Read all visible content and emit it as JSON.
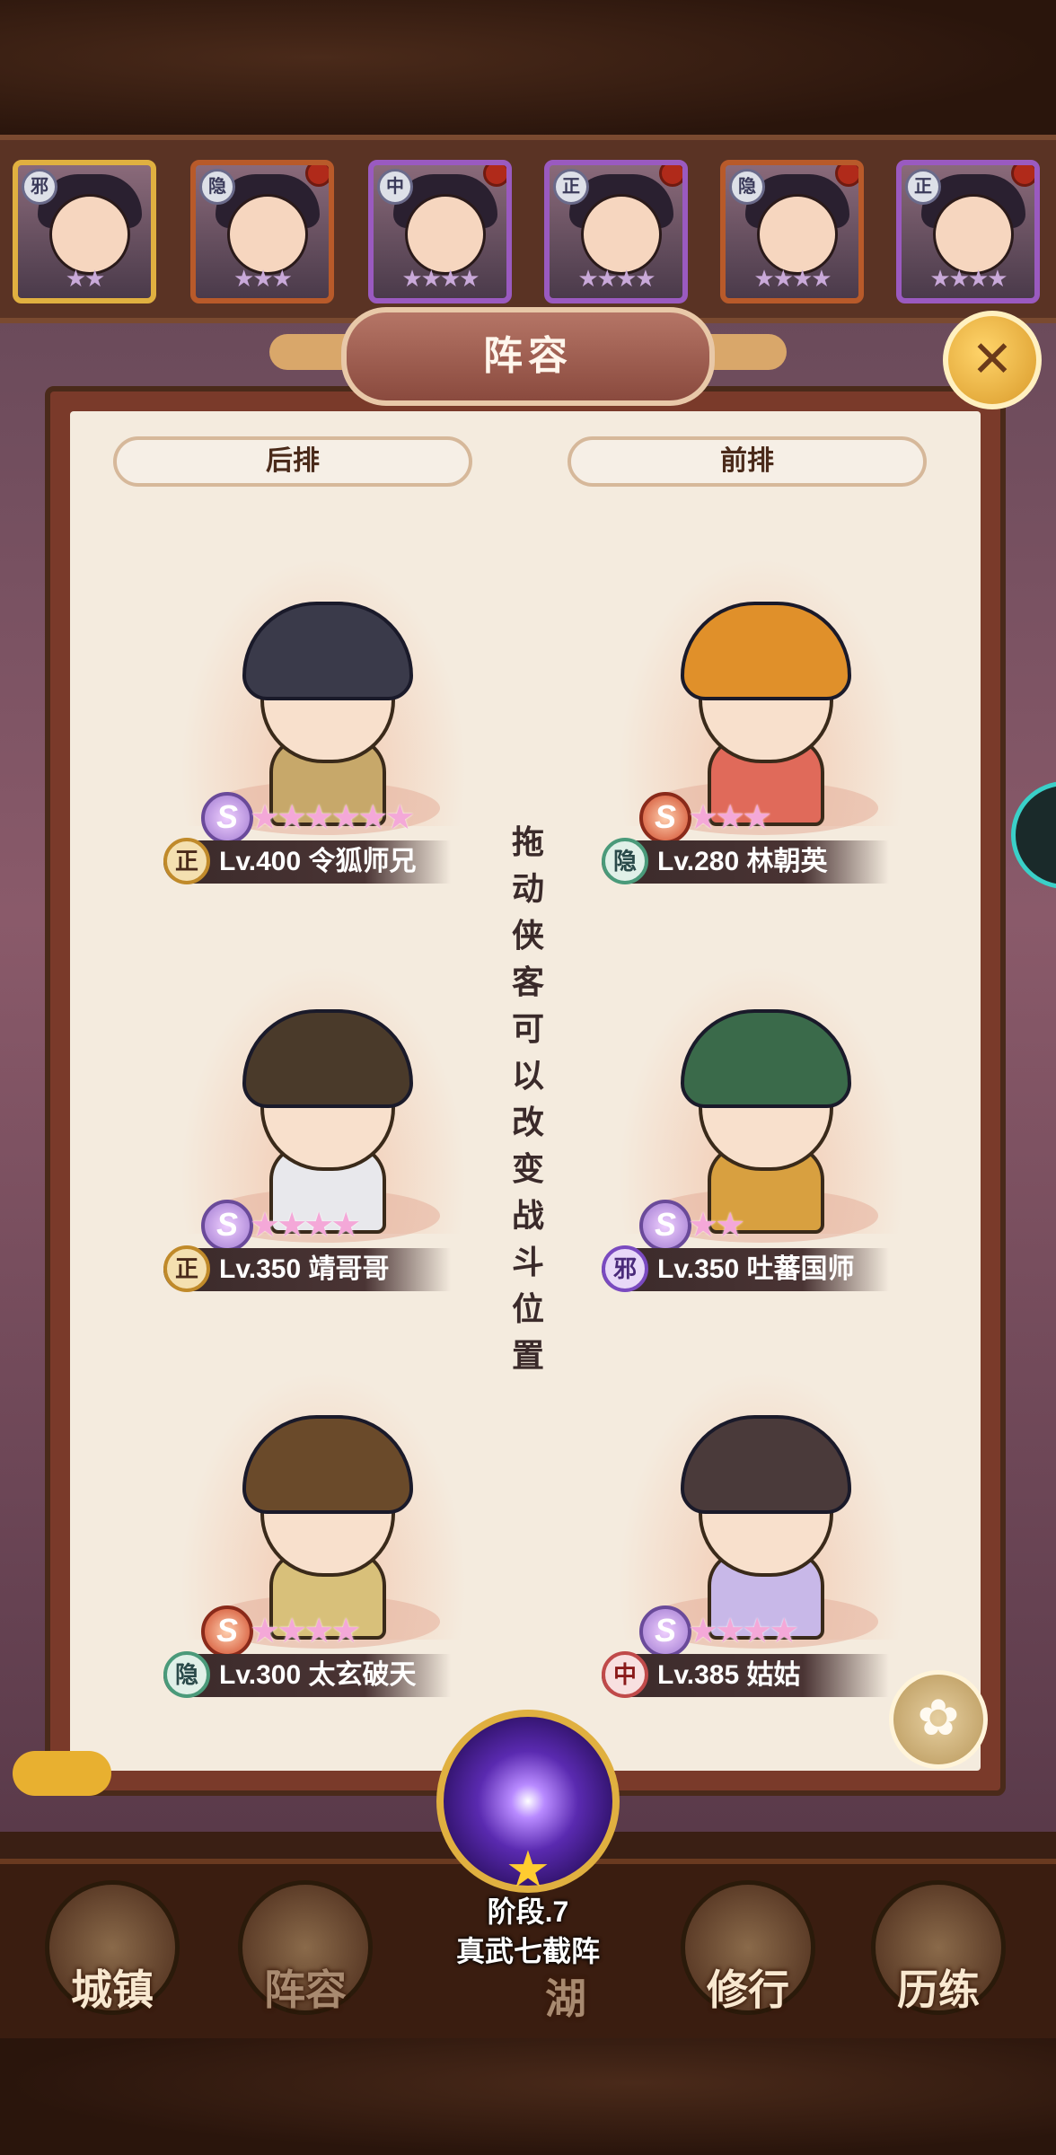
{
  "panel": {
    "title": "阵容",
    "close_icon": "close-icon",
    "back_row_label": "后排",
    "front_row_label": "前排",
    "drag_hint": "拖动侠客可以改变战斗位置"
  },
  "top_heroes": [
    {
      "faction": "邪",
      "stars": "★★"
    },
    {
      "faction": "隐",
      "stars": "★★★"
    },
    {
      "faction": "中",
      "stars": "★★★★"
    },
    {
      "faction": "正",
      "stars": "★★★★"
    },
    {
      "faction": "隐",
      "stars": "★★★★"
    },
    {
      "faction": "正",
      "stars": "★★★★"
    }
  ],
  "slots": {
    "back": [
      {
        "faction": "正",
        "name": "Lv.400 令狐师兄",
        "stars": "★★★★★★",
        "stars_count": 6
      },
      {
        "faction": "正",
        "name": "Lv.350 靖哥哥",
        "stars": "★★★★",
        "stars_count": 4
      },
      {
        "faction": "隐",
        "name": "Lv.300 太玄破天",
        "stars": "★★★★",
        "stars_count": 4
      }
    ],
    "front": [
      {
        "faction": "隐",
        "name": "Lv.280 林朝英",
        "stars": "★★★",
        "stars_count": 3
      },
      {
        "faction": "邪",
        "name": "Lv.350 吐蕃国师",
        "stars": "★★",
        "stars_count": 2
      },
      {
        "faction": "中",
        "name": "Lv.385 姑姑",
        "stars": "★★★★",
        "stars_count": 4
      }
    ]
  },
  "formation": {
    "stage": "阶段.7",
    "name": "真武七截阵",
    "star": "★"
  },
  "nav": {
    "items": [
      {
        "label": "城镇"
      },
      {
        "label": "阵容"
      },
      {
        "label": "湖"
      },
      {
        "label": "修行"
      },
      {
        "label": "历练"
      }
    ]
  },
  "colors": {
    "panel_bg": "#f4ebde",
    "panel_frame": "#7a3a2a",
    "star_pink": "#f4a8d8",
    "accent_gold": "#e0b040"
  }
}
